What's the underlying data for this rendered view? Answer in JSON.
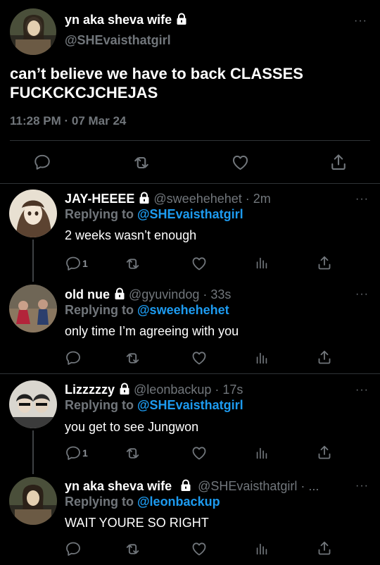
{
  "main_tweet": {
    "name": "yn aka sheva wife",
    "handle": "@SHEvaisthatgirl",
    "text": "can’t believe we have to back CLASSES FUCKCKCJCHEJAS",
    "meta": "11:28 PM · 07 Mar 24",
    "more": "···"
  },
  "replies": [
    {
      "name": "JAY-HEEEE",
      "handle": "@sweehehehet",
      "time": "· 2m",
      "replying_prefix": "Replying to ",
      "replying_to": "@SHEvaisthatgirl",
      "text": "2 weeks wasn’t enough",
      "reply_count": "1",
      "more": "···"
    },
    {
      "name": "old nue",
      "handle": "@gyuvindog",
      "time": "· 33s",
      "replying_prefix": "Replying to ",
      "replying_to": "@sweehehehet",
      "text": "only time I’m agreeing with you",
      "reply_count": "",
      "more": "···"
    },
    {
      "name": "Lizzzzzy",
      "handle": "@leonbackup",
      "time": "· 17s",
      "replying_prefix": "Replying to ",
      "replying_to": "@SHEvaisthatgirl",
      "text": "you get to see Jungwon",
      "reply_count": "1",
      "more": "···"
    },
    {
      "name": "yn aka sheva wife",
      "handle": "@SHEvaisthatgirl · ...",
      "time": "",
      "replying_prefix": "Replying to ",
      "replying_to": "@leonbackup",
      "text": "WAIT YOURE SO RIGHT",
      "reply_count": "",
      "more": "···"
    }
  ],
  "icons": {
    "reply": "reply-icon",
    "retweet": "retweet-icon",
    "like": "like-icon",
    "share": "share-icon",
    "analytics": "analytics-icon",
    "lock": "lock-icon"
  },
  "colors": {
    "background": "#000000",
    "text": "#e7e9ea",
    "secondary": "#71767b",
    "link": "#1d9bf0",
    "divider": "#2f3336"
  }
}
